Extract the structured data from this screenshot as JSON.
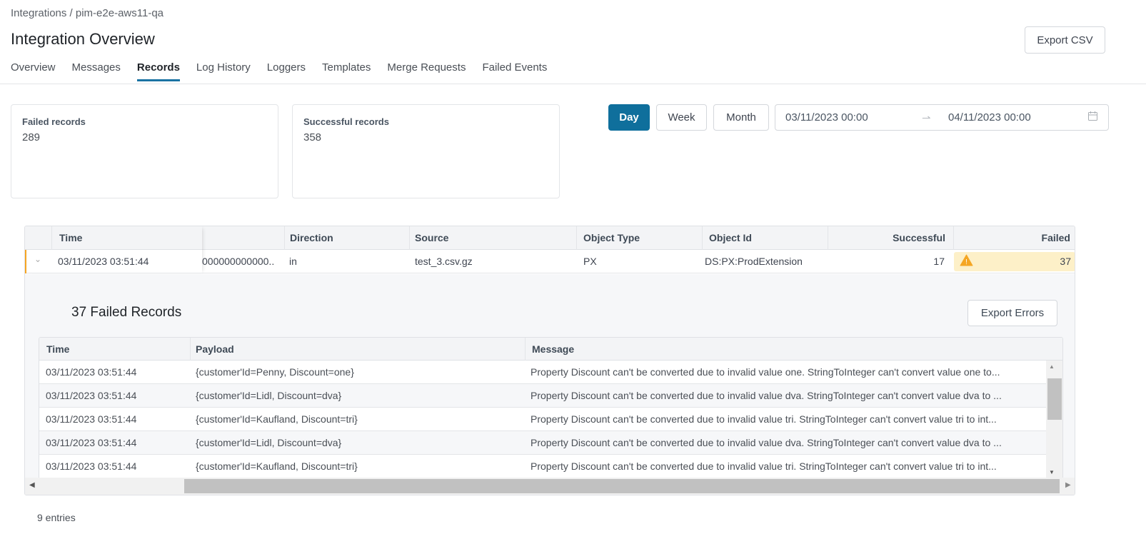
{
  "breadcrumb": "Integrations / pim-e2e-aws11-qa",
  "title": "Integration Overview",
  "export_csv": "Export CSV",
  "tabs": [
    "Overview",
    "Messages",
    "Records",
    "Log History",
    "Loggers",
    "Templates",
    "Merge Requests",
    "Failed Events"
  ],
  "active_tab": "Records",
  "cards": [
    {
      "label": "Failed records",
      "value": "289"
    },
    {
      "label": "Successful records",
      "value": "358"
    }
  ],
  "period": {
    "day": "Day",
    "week": "Week",
    "month": "Month",
    "selected": "Day"
  },
  "range": {
    "start": "03/11/2023 00:00",
    "end": "04/11/2023 00:00"
  },
  "table": {
    "headers": {
      "time": "Time",
      "direction": "Direction",
      "source": "Source",
      "object_type": "Object Type",
      "object_id": "Object Id",
      "successful": "Successful",
      "failed": "Failed"
    },
    "row": {
      "time": "03/11/2023 03:51:44",
      "hidden": "000000000000...",
      "direction": "in",
      "source": "test_3.csv.gz",
      "object_type": "PX",
      "object_id": "DS:PX:ProdExtension",
      "successful": "17",
      "failed": "37"
    }
  },
  "detail": {
    "title": "37 Failed Records",
    "export_errors": "Export Errors",
    "headers": {
      "time": "Time",
      "payload": "Payload",
      "message": "Message"
    },
    "rows": [
      {
        "time": "03/11/2023 03:51:44",
        "payload": "{customer'Id=Penny, Discount=one}",
        "message": "Property Discount can't be converted due to invalid value one. StringToInteger can't convert value one to..."
      },
      {
        "time": "03/11/2023 03:51:44",
        "payload": "{customer'Id=Lidl, Discount=dva}",
        "message": "Property Discount can't be converted due to invalid value dva. StringToInteger can't convert value dva to ..."
      },
      {
        "time": "03/11/2023 03:51:44",
        "payload": "{customer'Id=Kaufland, Discount=tri}",
        "message": "Property Discount can't be converted due to invalid value tri. StringToInteger can't convert value tri to int..."
      },
      {
        "time": "03/11/2023 03:51:44",
        "payload": "{customer'Id=Lidl, Discount=dva}",
        "message": "Property Discount can't be converted due to invalid value dva. StringToInteger can't convert value dva to ..."
      },
      {
        "time": "03/11/2023 03:51:44",
        "payload": "{customer'Id=Kaufland, Discount=tri}",
        "message": "Property Discount can't be converted due to invalid value tri. StringToInteger can't convert value tri to int..."
      }
    ]
  },
  "entries": "9 entries",
  "colors": {
    "accent": "#0f6f9c",
    "warning": "#f5a623",
    "warning_bg": "#fdf0c8"
  }
}
